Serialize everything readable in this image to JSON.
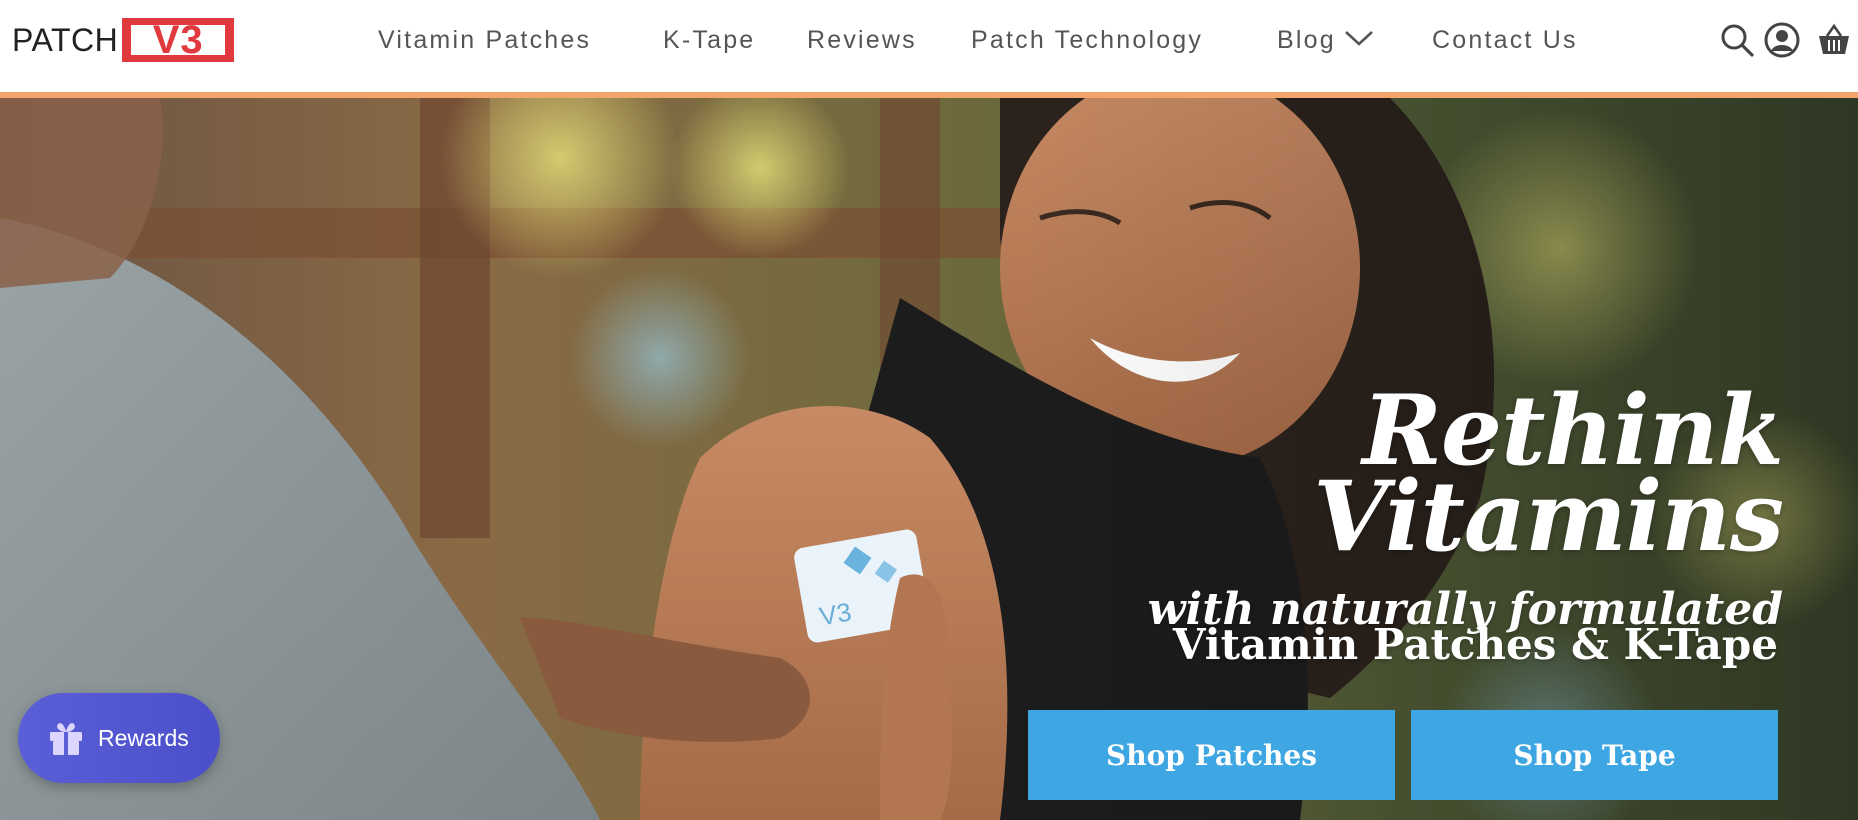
{
  "brand": {
    "logo_text": "PATCH",
    "logo_badge": "V3"
  },
  "nav": {
    "items": [
      {
        "label": "Vitamin Patches"
      },
      {
        "label": "K-Tape"
      },
      {
        "label": "Reviews"
      },
      {
        "label": "Patch Technology"
      },
      {
        "label": "Blog"
      },
      {
        "label": "Contact Us"
      }
    ]
  },
  "header_icons": [
    "search-icon",
    "account-icon",
    "cart-icon"
  ],
  "hero": {
    "title_line1": "Rethink",
    "title_line2": "Vitamins",
    "subtitle_line1": "with naturally formulated",
    "subtitle_line2": "Vitamin Patches & K-Tape",
    "patch_label": "V3",
    "buttons": {
      "shop_patches": "Shop Patches",
      "shop_tape": "Shop Tape"
    }
  },
  "rewards": {
    "label": "Rewards",
    "icon": "gift-icon"
  },
  "colors": {
    "accent_bar": "#f3a46a",
    "cta_blue": "#3ea6e2",
    "logo_red": "#e0393e",
    "rewards_purple": "#5a5fd8"
  }
}
